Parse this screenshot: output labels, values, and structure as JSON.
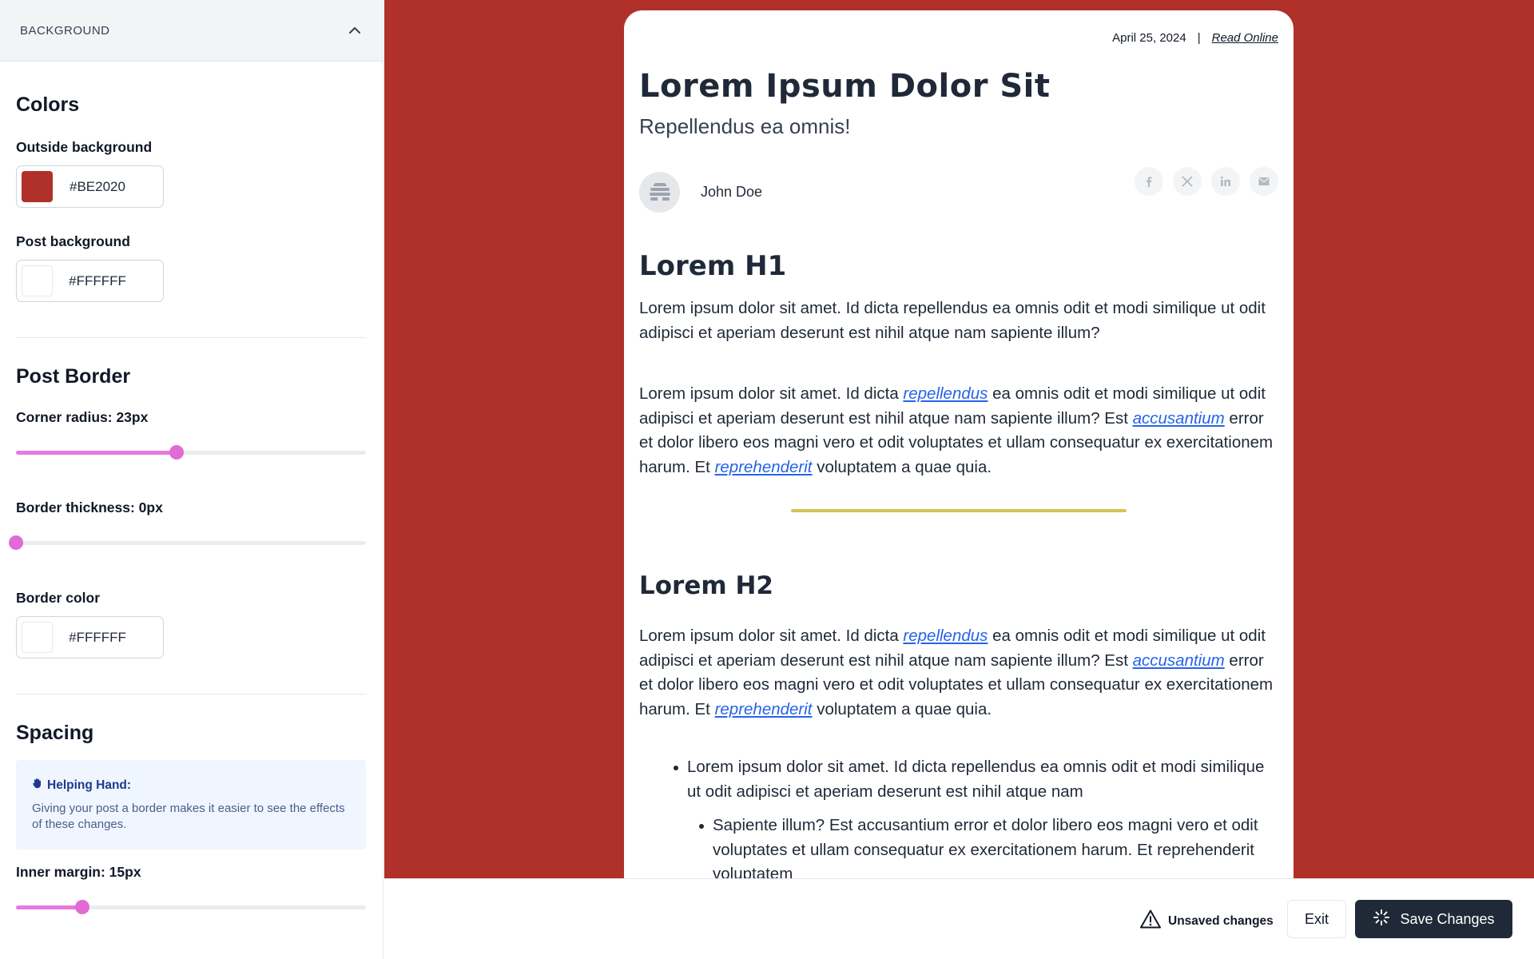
{
  "sidebar": {
    "section_title": "BACKGROUND",
    "colors": {
      "title": "Colors",
      "outside_label": "Outside background",
      "outside_value": "#BE2020",
      "post_label": "Post background",
      "post_value": "#FFFFFF"
    },
    "border": {
      "title": "Post Border",
      "radius_label": "Corner radius: 23px",
      "radius_fraction": 0.46,
      "thickness_label": "Border thickness: 0px",
      "thickness_fraction": 0,
      "color_label": "Border color",
      "color_value": "#FFFFFF"
    },
    "spacing": {
      "title": "Spacing",
      "tip_title": "Helping Hand:",
      "tip_text": "Giving your post a border makes it easier to see the effects of these changes.",
      "inner_label": "Inner margin: 15px",
      "inner_fraction": 0.19
    }
  },
  "post": {
    "date": "April 25, 2024",
    "separator": "|",
    "read_online": "Read Online",
    "title": "Lorem Ipsum Dolor Sit",
    "subtitle": "Repellendus ea omnis!",
    "author": "John Doe",
    "share_icons": [
      "facebook-icon",
      "x-icon",
      "linkedin-icon",
      "email-icon"
    ],
    "h1": "Lorem H1",
    "p1": "Lorem ipsum dolor sit amet. Id dicta repellendus ea omnis odit et modi similique ut odit adipisci et aperiam deserunt est nihil atque nam sapiente illum?",
    "p2": {
      "t1": "Lorem ipsum dolor sit amet. Id dicta ",
      "l1": "repellendus",
      "t2": " ea omnis odit et modi similique ut odit adipisci et aperiam deserunt est nihil atque nam sapiente illum? Est ",
      "l2": "accusantium",
      "t3": " error et dolor libero eos magni vero et odit voluptates et ullam consequatur ex exercitationem harum. Et ",
      "l3": "reprehenderit",
      "t4": " voluptatem a quae quia."
    },
    "h2": "Lorem H2",
    "p3": {
      "t1": "Lorem ipsum dolor sit amet. Id dicta ",
      "l1": "repellendus",
      "t2": " ea omnis odit et modi similique ut odit adipisci et aperiam deserunt est nihil atque nam sapiente illum? Est ",
      "l2": "accusantium",
      "t3": " error et dolor libero eos magni vero et odit voluptates et ullam consequatur ex exercitationem harum. Et ",
      "l3": "reprehenderit",
      "t4": " voluptatem a quae quia."
    },
    "list_item": "Lorem ipsum dolor sit amet. Id dicta repellendus ea omnis odit et modi similique ut odit adipisci et aperiam deserunt est nihil atque nam",
    "list_subitem": "Sapiente illum? Est accusantium error et dolor libero eos magni vero et odit voluptates et ullam consequatur ex exercitationem harum. Et reprehenderit voluptatem"
  },
  "footer": {
    "unsaved": "Unsaved changes",
    "exit": "Exit",
    "save": "Save Changes"
  },
  "colors": {
    "canvas_bg": "#B0302A",
    "accent": "#E26AD6",
    "save_bg": "#1F2937",
    "link": "#2563EB",
    "rule": "#D4C45A"
  }
}
